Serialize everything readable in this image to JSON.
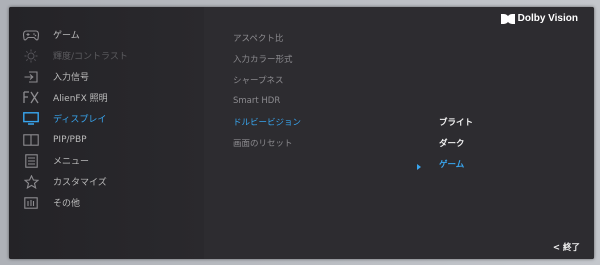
{
  "brand": {
    "logo_text": "Dolby Vision"
  },
  "sidebar": {
    "items": [
      {
        "label": "ゲーム",
        "icon": "gamepad-icon",
        "state": "normal"
      },
      {
        "label": "輝度/コントラスト",
        "icon": "brightness-icon",
        "state": "disabled"
      },
      {
        "label": "入力信号",
        "icon": "input-icon",
        "state": "normal"
      },
      {
        "label": "AlienFX 照明",
        "icon": "fx-icon",
        "state": "normal"
      },
      {
        "label": "ディスプレイ",
        "icon": "monitor-icon",
        "state": "active"
      },
      {
        "label": "PIP/PBP",
        "icon": "pip-icon",
        "state": "normal"
      },
      {
        "label": "メニュー",
        "icon": "menu-list-icon",
        "state": "normal"
      },
      {
        "label": "カスタマイズ",
        "icon": "star-icon",
        "state": "normal"
      },
      {
        "label": "その他",
        "icon": "info-icon",
        "state": "normal"
      }
    ]
  },
  "submenu": {
    "items": [
      {
        "label": "アスペクト比",
        "state": "normal"
      },
      {
        "label": "入力カラー形式",
        "state": "normal"
      },
      {
        "label": "シャープネス",
        "state": "normal"
      },
      {
        "label": "Smart HDR",
        "state": "normal"
      },
      {
        "label": "ドルビービジョン",
        "state": "active"
      },
      {
        "label": "画面のリセット",
        "state": "normal"
      }
    ]
  },
  "options": {
    "items": [
      {
        "label": "ブライト",
        "selected": false
      },
      {
        "label": "ダーク",
        "selected": false
      },
      {
        "label": "ゲーム",
        "selected": true
      }
    ]
  },
  "footer": {
    "exit_label": "< 終了"
  },
  "colors": {
    "accent": "#38a6f0",
    "panel_bg": "#2b2a2e",
    "sidebar_bg": "#252428",
    "text_normal": "#bcbcbc",
    "text_disabled": "#5c5b5f"
  }
}
